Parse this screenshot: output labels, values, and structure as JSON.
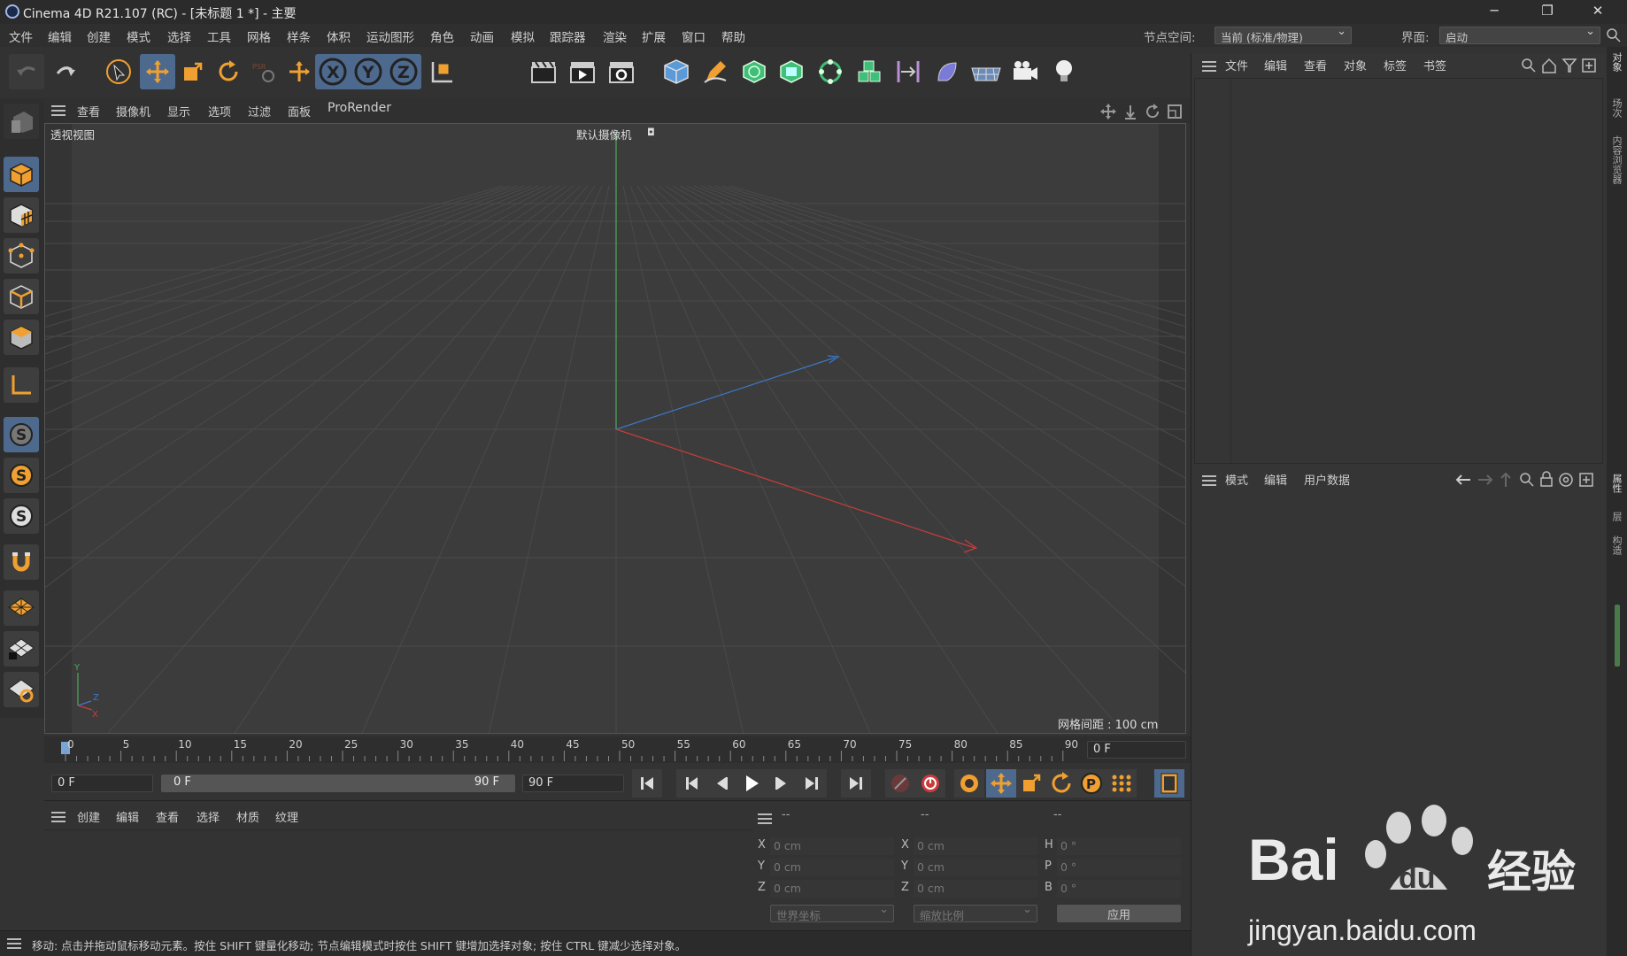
{
  "window": {
    "title": "Cinema 4D R21.107 (RC) - [未标题 1 *] - 主要",
    "minimize": "─",
    "restore": "❐",
    "close": "✕"
  },
  "menu": [
    "文件",
    "编辑",
    "创建",
    "模式",
    "选择",
    "工具",
    "网格",
    "样条",
    "体积",
    "运动图形",
    "角色",
    "动画",
    "模拟",
    "跟踪器",
    "渲染",
    "扩展",
    "窗口",
    "帮助"
  ],
  "node_space": {
    "label": "节点空间:",
    "value": "当前 (标准/物理)"
  },
  "layout": {
    "label": "界面:",
    "value": "启动"
  },
  "viewport": {
    "menu": [
      "查看",
      "摄像机",
      "显示",
      "选项",
      "过滤",
      "面板",
      "ProRender"
    ],
    "view_name": "透视视图",
    "camera_name": "默认摄像机",
    "grid_spacing": "网格间距 : 100 cm",
    "axis_labels": {
      "y": "Y",
      "z": "Z",
      "x": "X"
    }
  },
  "timeline": {
    "ticks": [
      "0",
      "5",
      "10",
      "15",
      "20",
      "25",
      "30",
      "35",
      "40",
      "45",
      "50",
      "55",
      "60",
      "65",
      "70",
      "75",
      "80",
      "85",
      "90"
    ],
    "current_frame": "0 F"
  },
  "transport": {
    "start_frame": "0 F",
    "range_start": "0 F",
    "range_end": "90 F",
    "end_frame": "90 F"
  },
  "material_panel": {
    "menu": [
      "创建",
      "编辑",
      "查看",
      "选择",
      "材质",
      "纹理"
    ]
  },
  "coord_panel": {
    "headers": [
      "--",
      "--",
      "--"
    ],
    "rows": [
      {
        "a": "X",
        "av": "0 cm",
        "b": "X",
        "bv": "0 cm",
        "c": "H",
        "cv": "0 °"
      },
      {
        "a": "Y",
        "av": "0 cm",
        "b": "Y",
        "bv": "0 cm",
        "c": "P",
        "cv": "0 °"
      },
      {
        "a": "Z",
        "av": "0 cm",
        "b": "Z",
        "bv": "0 cm",
        "c": "B",
        "cv": "0 °"
      }
    ],
    "world_coords": "世界坐标",
    "scale_mode": "缩放比例",
    "apply": "应用"
  },
  "object_panel": {
    "menu": [
      "文件",
      "编辑",
      "查看",
      "对象",
      "标签",
      "书签"
    ]
  },
  "attr_panel": {
    "menu": [
      "模式",
      "编辑",
      "用户数据"
    ]
  },
  "side_tabs": {
    "top": [
      "对象",
      "场次",
      "内容浏览器"
    ],
    "bottom": [
      "属性",
      "层",
      "构造"
    ]
  },
  "status": "移动: 点击并拖动鼠标移动元素。按住 SHIFT 键量化移动; 节点编辑模式时按住 SHIFT 键增加选择对象; 按住 CTRL 键减少选择对象。",
  "watermark": {
    "brand": "Bai",
    "suffix": "经验",
    "url": "jingyan.baidu.com"
  },
  "colors": {
    "selected": "#4d6a8e",
    "accent": "#f0a030",
    "axis_x": "#c83c3c",
    "axis_y": "#4caa5a",
    "axis_z": "#3c78c8"
  }
}
